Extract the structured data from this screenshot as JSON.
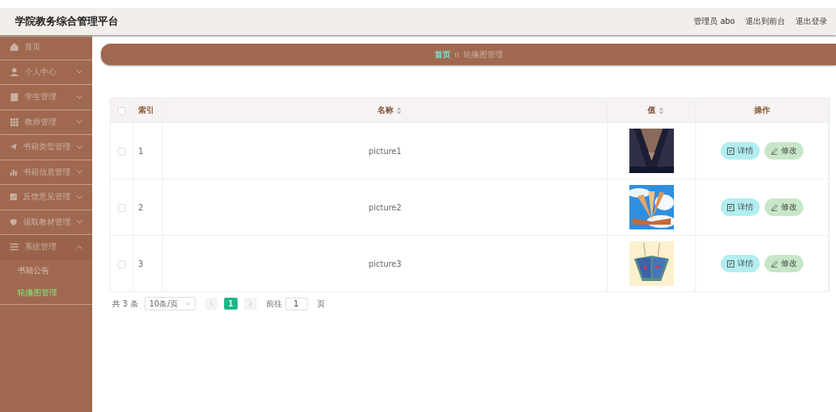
{
  "header": {
    "title": "学院教务综合管理平台",
    "links": [
      "管理员 abo",
      "退出到前台",
      "退出登录"
    ]
  },
  "sidebar": {
    "items": [
      {
        "label": "首页",
        "kind": "link"
      },
      {
        "label": "个人中心",
        "kind": "menu",
        "expanded": false
      },
      {
        "label": "学生管理",
        "kind": "menu",
        "expanded": false
      },
      {
        "label": "教师管理",
        "kind": "menu",
        "expanded": false
      },
      {
        "label": "书籍类型管理",
        "kind": "menu",
        "expanded": false
      },
      {
        "label": "书籍信息管理",
        "kind": "menu",
        "expanded": false
      },
      {
        "label": "反馈意见管理",
        "kind": "menu",
        "expanded": false
      },
      {
        "label": "领取教材管理",
        "kind": "menu",
        "expanded": false
      },
      {
        "label": "系统管理",
        "kind": "menu",
        "expanded": true,
        "children": [
          {
            "label": "书籍公告",
            "selected": false
          },
          {
            "label": "轮播图管理",
            "selected": true
          }
        ]
      }
    ]
  },
  "breadcrumb": [
    "首页",
    "轮播图管理"
  ],
  "table": {
    "all_checked": false,
    "columns": [
      {
        "label": "索引",
        "sortable": false
      },
      {
        "label": "名称",
        "sortable": true
      },
      {
        "label": "值",
        "sortable": true
      },
      {
        "label": "操作",
        "sortable": false
      }
    ],
    "rows": [
      {
        "index": "1",
        "name": "picture1",
        "checked": false,
        "picture": {
          "kind": "picture"
        },
        "actions": [
          "详情",
          "修改"
        ]
      },
      {
        "index": "2",
        "name": "picture2",
        "checked": false,
        "picture": {
          "kind": "picture"
        },
        "actions": [
          "详情",
          "修改"
        ]
      },
      {
        "index": "3",
        "name": "picture3",
        "checked": false,
        "picture": {
          "kind": "picture"
        },
        "actions": [
          "详情",
          "修改"
        ]
      }
    ]
  },
  "pagination": {
    "total": "共 3 条",
    "page_size": "10条/页",
    "pages": [
      {
        "label": "1",
        "selected": true
      }
    ],
    "goto_label": "前往",
    "goto_value": "1",
    "goto_suffix": "页"
  }
}
